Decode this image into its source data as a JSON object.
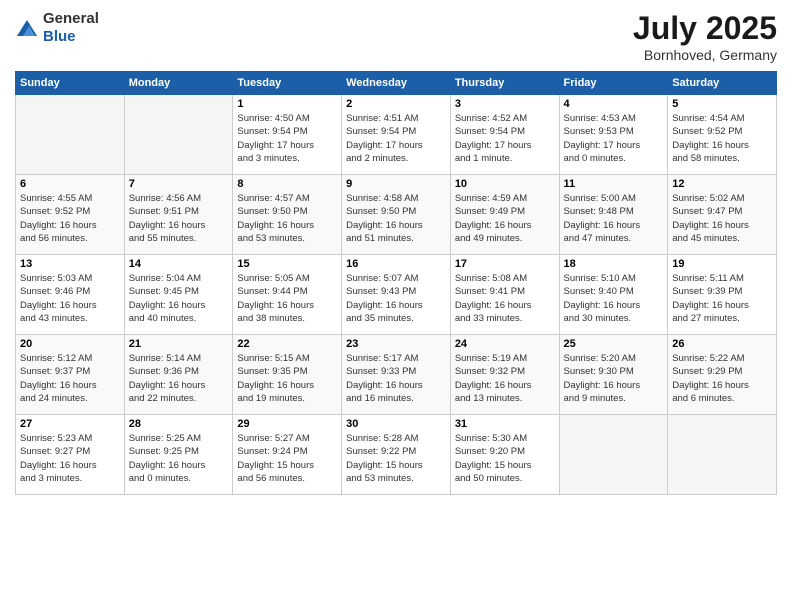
{
  "logo": {
    "general": "General",
    "blue": "Blue"
  },
  "title": "July 2025",
  "location": "Bornhoved, Germany",
  "days_of_week": [
    "Sunday",
    "Monday",
    "Tuesday",
    "Wednesday",
    "Thursday",
    "Friday",
    "Saturday"
  ],
  "weeks": [
    [
      {
        "day": "",
        "info": ""
      },
      {
        "day": "",
        "info": ""
      },
      {
        "day": "1",
        "info": "Sunrise: 4:50 AM\nSunset: 9:54 PM\nDaylight: 17 hours\nand 3 minutes."
      },
      {
        "day": "2",
        "info": "Sunrise: 4:51 AM\nSunset: 9:54 PM\nDaylight: 17 hours\nand 2 minutes."
      },
      {
        "day": "3",
        "info": "Sunrise: 4:52 AM\nSunset: 9:54 PM\nDaylight: 17 hours\nand 1 minute."
      },
      {
        "day": "4",
        "info": "Sunrise: 4:53 AM\nSunset: 9:53 PM\nDaylight: 17 hours\nand 0 minutes."
      },
      {
        "day": "5",
        "info": "Sunrise: 4:54 AM\nSunset: 9:52 PM\nDaylight: 16 hours\nand 58 minutes."
      }
    ],
    [
      {
        "day": "6",
        "info": "Sunrise: 4:55 AM\nSunset: 9:52 PM\nDaylight: 16 hours\nand 56 minutes."
      },
      {
        "day": "7",
        "info": "Sunrise: 4:56 AM\nSunset: 9:51 PM\nDaylight: 16 hours\nand 55 minutes."
      },
      {
        "day": "8",
        "info": "Sunrise: 4:57 AM\nSunset: 9:50 PM\nDaylight: 16 hours\nand 53 minutes."
      },
      {
        "day": "9",
        "info": "Sunrise: 4:58 AM\nSunset: 9:50 PM\nDaylight: 16 hours\nand 51 minutes."
      },
      {
        "day": "10",
        "info": "Sunrise: 4:59 AM\nSunset: 9:49 PM\nDaylight: 16 hours\nand 49 minutes."
      },
      {
        "day": "11",
        "info": "Sunrise: 5:00 AM\nSunset: 9:48 PM\nDaylight: 16 hours\nand 47 minutes."
      },
      {
        "day": "12",
        "info": "Sunrise: 5:02 AM\nSunset: 9:47 PM\nDaylight: 16 hours\nand 45 minutes."
      }
    ],
    [
      {
        "day": "13",
        "info": "Sunrise: 5:03 AM\nSunset: 9:46 PM\nDaylight: 16 hours\nand 43 minutes."
      },
      {
        "day": "14",
        "info": "Sunrise: 5:04 AM\nSunset: 9:45 PM\nDaylight: 16 hours\nand 40 minutes."
      },
      {
        "day": "15",
        "info": "Sunrise: 5:05 AM\nSunset: 9:44 PM\nDaylight: 16 hours\nand 38 minutes."
      },
      {
        "day": "16",
        "info": "Sunrise: 5:07 AM\nSunset: 9:43 PM\nDaylight: 16 hours\nand 35 minutes."
      },
      {
        "day": "17",
        "info": "Sunrise: 5:08 AM\nSunset: 9:41 PM\nDaylight: 16 hours\nand 33 minutes."
      },
      {
        "day": "18",
        "info": "Sunrise: 5:10 AM\nSunset: 9:40 PM\nDaylight: 16 hours\nand 30 minutes."
      },
      {
        "day": "19",
        "info": "Sunrise: 5:11 AM\nSunset: 9:39 PM\nDaylight: 16 hours\nand 27 minutes."
      }
    ],
    [
      {
        "day": "20",
        "info": "Sunrise: 5:12 AM\nSunset: 9:37 PM\nDaylight: 16 hours\nand 24 minutes."
      },
      {
        "day": "21",
        "info": "Sunrise: 5:14 AM\nSunset: 9:36 PM\nDaylight: 16 hours\nand 22 minutes."
      },
      {
        "day": "22",
        "info": "Sunrise: 5:15 AM\nSunset: 9:35 PM\nDaylight: 16 hours\nand 19 minutes."
      },
      {
        "day": "23",
        "info": "Sunrise: 5:17 AM\nSunset: 9:33 PM\nDaylight: 16 hours\nand 16 minutes."
      },
      {
        "day": "24",
        "info": "Sunrise: 5:19 AM\nSunset: 9:32 PM\nDaylight: 16 hours\nand 13 minutes."
      },
      {
        "day": "25",
        "info": "Sunrise: 5:20 AM\nSunset: 9:30 PM\nDaylight: 16 hours\nand 9 minutes."
      },
      {
        "day": "26",
        "info": "Sunrise: 5:22 AM\nSunset: 9:29 PM\nDaylight: 16 hours\nand 6 minutes."
      }
    ],
    [
      {
        "day": "27",
        "info": "Sunrise: 5:23 AM\nSunset: 9:27 PM\nDaylight: 16 hours\nand 3 minutes."
      },
      {
        "day": "28",
        "info": "Sunrise: 5:25 AM\nSunset: 9:25 PM\nDaylight: 16 hours\nand 0 minutes."
      },
      {
        "day": "29",
        "info": "Sunrise: 5:27 AM\nSunset: 9:24 PM\nDaylight: 15 hours\nand 56 minutes."
      },
      {
        "day": "30",
        "info": "Sunrise: 5:28 AM\nSunset: 9:22 PM\nDaylight: 15 hours\nand 53 minutes."
      },
      {
        "day": "31",
        "info": "Sunrise: 5:30 AM\nSunset: 9:20 PM\nDaylight: 15 hours\nand 50 minutes."
      },
      {
        "day": "",
        "info": ""
      },
      {
        "day": "",
        "info": ""
      }
    ]
  ]
}
